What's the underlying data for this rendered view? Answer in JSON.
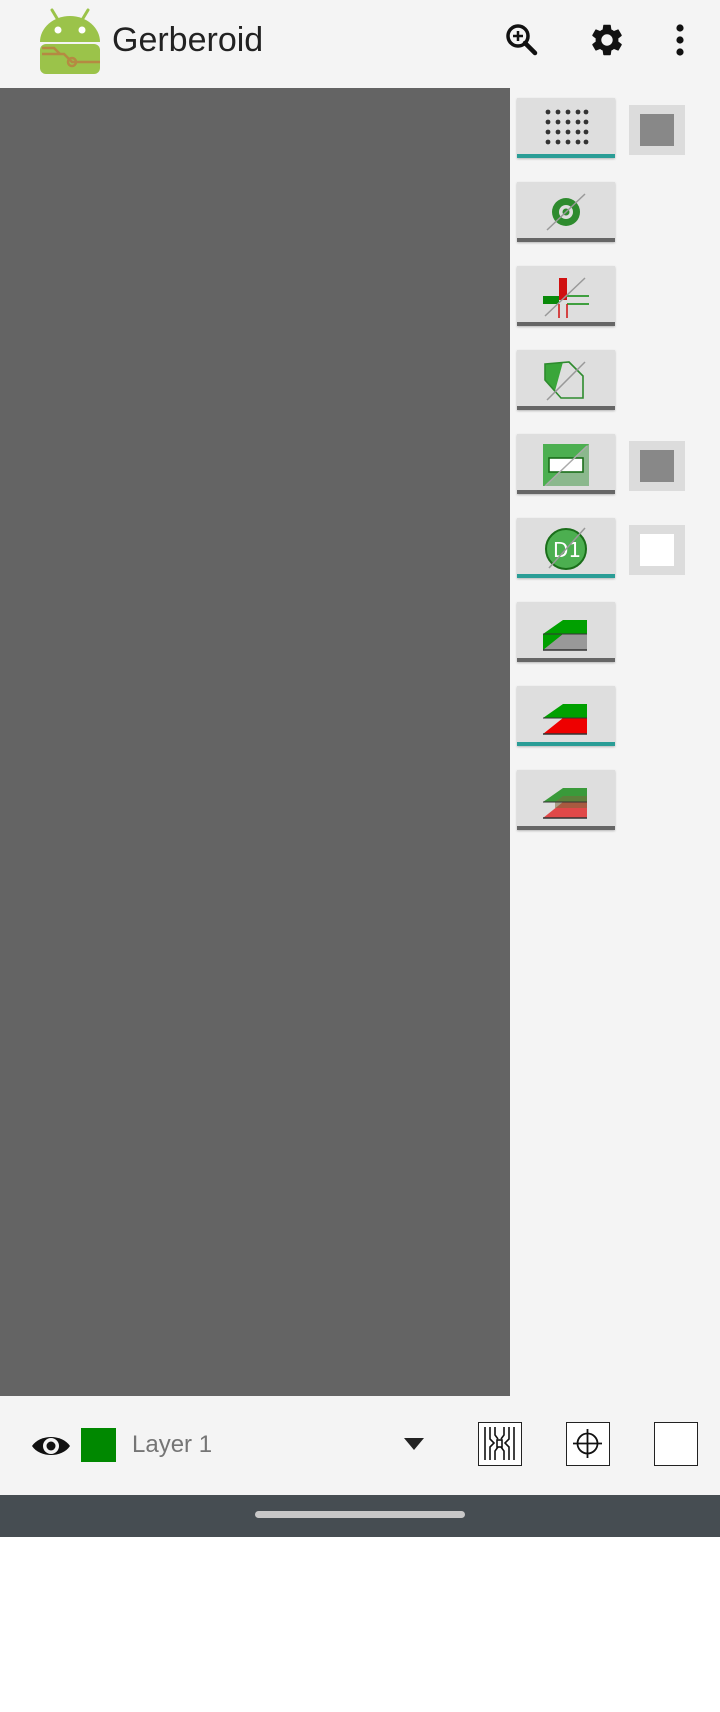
{
  "app": {
    "title": "Gerberoid"
  },
  "toolbar": {
    "icons": [
      "zoom-in-icon",
      "gear-icon",
      "more-vert-icon"
    ]
  },
  "side_tools": [
    {
      "icon": "grid-dots-icon",
      "active": true
    },
    {
      "icon": "pad-ring-icon",
      "active": false
    },
    {
      "icon": "tracks-icon",
      "active": false
    },
    {
      "icon": "polygon-fill-icon",
      "active": false
    },
    {
      "icon": "region-fill-icon",
      "active": false
    },
    {
      "icon": "dcode-icon",
      "active": true,
      "text": "D1"
    },
    {
      "icon": "layer-stack-gray-icon",
      "active": false
    },
    {
      "icon": "layer-stack-red-icon",
      "active": true
    },
    {
      "icon": "layer-stack-transparent-icon",
      "active": false
    }
  ],
  "swatches": [
    {
      "color": "#888888"
    },
    {
      "color": "#888888"
    },
    {
      "color": "#ffffff"
    }
  ],
  "bottom": {
    "layer_name": "Layer 1",
    "layer_color": "#008800",
    "icons": [
      "eye-icon",
      "chevron-down-icon",
      "pcb-icon",
      "crosshair-icon",
      "blank-square-icon"
    ]
  },
  "colors": {
    "canvas": "#646464",
    "panel": "#f4f4f4",
    "accent": "#2a9d96",
    "navbar": "#464d52"
  }
}
